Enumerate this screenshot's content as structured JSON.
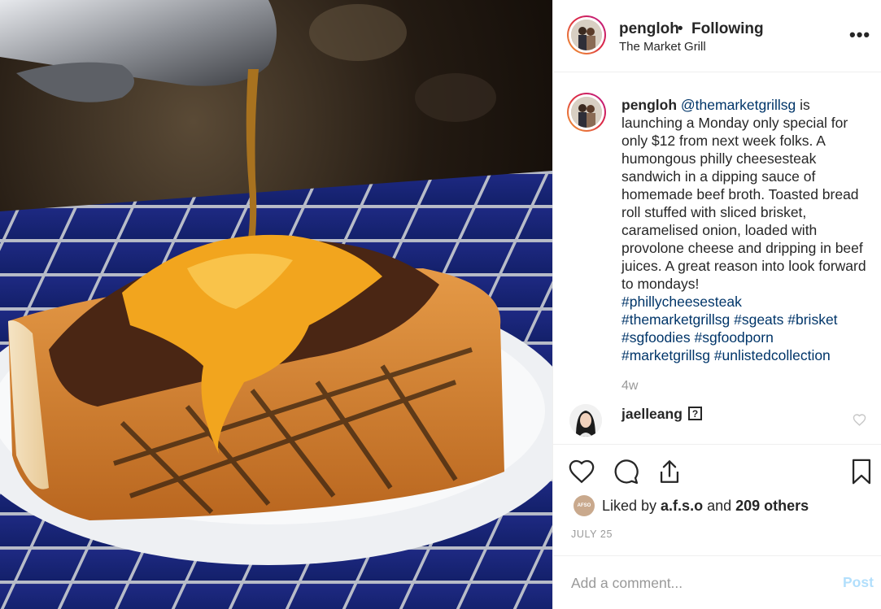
{
  "post": {
    "author": "pengloh",
    "separator": "•",
    "follow_status": "Following",
    "location": "The Market Grill",
    "more_icon": "more-horizontal-icon",
    "caption": {
      "author": "pengloh",
      "mention": "@themarketgrillsg",
      "text": " is launching a Monday only special for only $12 from next week folks. A humongous philly cheesesteak sandwich in a dipping sauce of homemade beef broth. Toasted bread roll stuffed with sliced brisket, caramelised onion, loaded with provolone cheese and dripping in beef juices. A great reason into look forward to mondays!",
      "hashtags": [
        "#phillycheesesteak",
        "#themarketgrillsg #sgeats #brisket",
        "#sgfoodies #sgfoodporn",
        "#marketgrillsg #unlistedcollection"
      ]
    },
    "age": "4w",
    "comment": {
      "user": "jaelleang",
      "badge": "?"
    },
    "actions": {
      "like_icon": "heart-icon",
      "comment_icon": "comment-icon",
      "share_icon": "share-icon",
      "save_icon": "bookmark-icon"
    },
    "likes": {
      "avatar_text": "AFSO",
      "prefix": "Liked by ",
      "user": "a.f.s.o",
      "middle": " and ",
      "others": "209 others"
    },
    "date": "JULY 25",
    "add_comment_placeholder": "Add a comment...",
    "post_button": "Post"
  },
  "colors": {
    "link": "#003569",
    "post_disabled": "#b2dffc",
    "muted": "#999999",
    "text": "#262626"
  }
}
